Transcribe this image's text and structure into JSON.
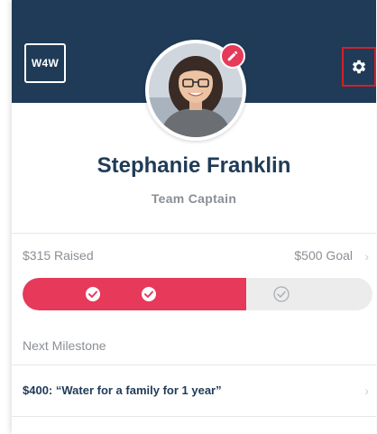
{
  "header": {
    "logo_text": "W4W",
    "settings_icon": "gear-icon",
    "background_color": "#1f3b57"
  },
  "profile": {
    "name": "Stephanie Franklin",
    "role": "Team Captain",
    "edit_icon": "pencil-icon"
  },
  "fundraising": {
    "raised_label": "$315 Raised",
    "goal_label": "$500 Goal",
    "progress_fraction": 0.64,
    "milestones": [
      {
        "position_fraction": 0.2,
        "completed": true
      },
      {
        "position_fraction": 0.36,
        "completed": true
      },
      {
        "position_fraction": 0.74,
        "completed": false
      }
    ],
    "accent_color": "#e7395a"
  },
  "next_milestone": {
    "label": "Next Milestone",
    "text": "$400: “Water for a family for 1 year”"
  }
}
